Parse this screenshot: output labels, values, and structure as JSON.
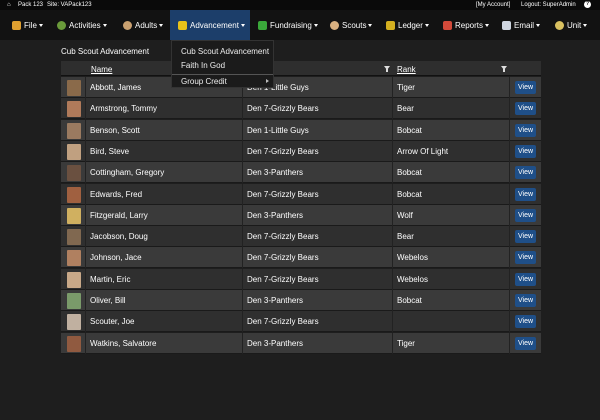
{
  "topbar": {
    "home_icon": "home-icon",
    "pack": "Pack 123",
    "site": "Site: VAPack123",
    "my_account": "[My Account]",
    "logout": "Logout: SuperAdmin",
    "help": "?"
  },
  "nav": {
    "items": [
      {
        "label": "File",
        "icon": "mug-icon",
        "color": "#e0a030"
      },
      {
        "label": "Activities",
        "icon": "activities-icon",
        "color": "#6a9a3a"
      },
      {
        "label": "Adults",
        "icon": "adults-icon",
        "color": "#c9a070"
      },
      {
        "label": "Advancement",
        "icon": "fleur-de-lis-icon",
        "color": "#e8c21a"
      },
      {
        "label": "Fundraising",
        "icon": "fundraising-icon",
        "color": "#3aa83a"
      },
      {
        "label": "Scouts",
        "icon": "scouts-icon",
        "color": "#d8b080"
      },
      {
        "label": "Ledger",
        "icon": "dollar-icon",
        "color": "#d4b020"
      },
      {
        "label": "Reports",
        "icon": "reports-icon",
        "color": "#d24a3a"
      },
      {
        "label": "Email",
        "icon": "email-icon",
        "color": "#cfd6e0"
      },
      {
        "label": "Unit",
        "icon": "unit-icon",
        "color": "#d8c060"
      }
    ]
  },
  "dropdown": {
    "items": [
      "Cub Scout Advancement",
      "Faith In God",
      "Group Credit"
    ]
  },
  "page": {
    "title": "Cub Scout Advancement"
  },
  "grid": {
    "headers": {
      "name": "Name",
      "rank": "Rank"
    },
    "view_label": "View",
    "rows": [
      {
        "name": "Abbott, James",
        "den": "Den 1-Little Guys",
        "rank": "Tiger"
      },
      {
        "name": "Armstrong, Tommy",
        "den": "Den 7-Grizzly Bears",
        "rank": "Bear"
      },
      {
        "name": "Benson, Scott",
        "den": "Den 1-Little Guys",
        "rank": "Bobcat"
      },
      {
        "name": "Bird, Steve",
        "den": "Den 7-Grizzly Bears",
        "rank": "Arrow Of Light"
      },
      {
        "name": "Cottingham, Gregory",
        "den": "Den 3-Panthers",
        "rank": "Bobcat"
      },
      {
        "name": "Edwards, Fred",
        "den": "Den 7-Grizzly Bears",
        "rank": "Bobcat"
      },
      {
        "name": "Fitzgerald, Larry",
        "den": "Den 3-Panthers",
        "rank": "Wolf"
      },
      {
        "name": "Jacobson, Doug",
        "den": "Den 7-Grizzly Bears",
        "rank": "Bear"
      },
      {
        "name": "Johnson, Jace",
        "den": "Den 7-Grizzly Bears",
        "rank": "Webelos"
      },
      {
        "name": "Martin, Eric",
        "den": "Den 7-Grizzly Bears",
        "rank": "Webelos"
      },
      {
        "name": "Oliver, Bill",
        "den": "Den 3-Panthers",
        "rank": "Bobcat"
      },
      {
        "name": "Scouter, Joe",
        "den": "Den 7-Grizzly Bears",
        "rank": ""
      },
      {
        "name": "Watkins, Salvatore",
        "den": "Den 3-Panthers",
        "rank": "Tiger"
      }
    ]
  }
}
